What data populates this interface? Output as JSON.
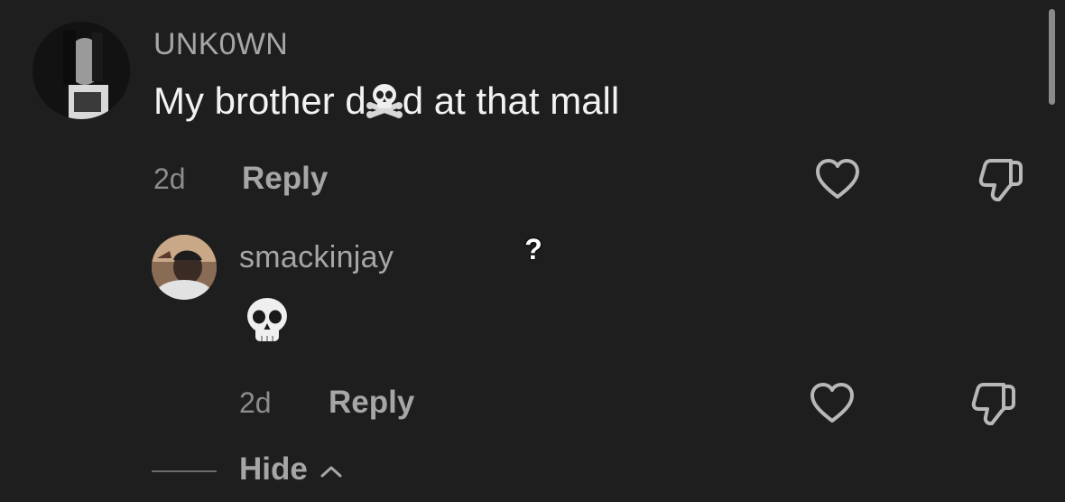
{
  "comments": [
    {
      "username": "UNK0WN",
      "text_before": "My brother d",
      "emoji_name": "skull-crossbones-icon",
      "text_after": "d at that mall",
      "time": "2d",
      "reply_label": "Reply"
    }
  ],
  "replies": [
    {
      "username": "smackinjay",
      "emoji_name": "skull-icon",
      "time": "2d",
      "reply_label": "Reply"
    }
  ],
  "thread": {
    "hide_label": "Hide"
  },
  "overlay": {
    "question_mark": "?"
  },
  "colors": {
    "background": "#1e1e1e",
    "username": "#a6a6a6",
    "text": "#f2f2f2",
    "meta": "#8c8c8c"
  }
}
